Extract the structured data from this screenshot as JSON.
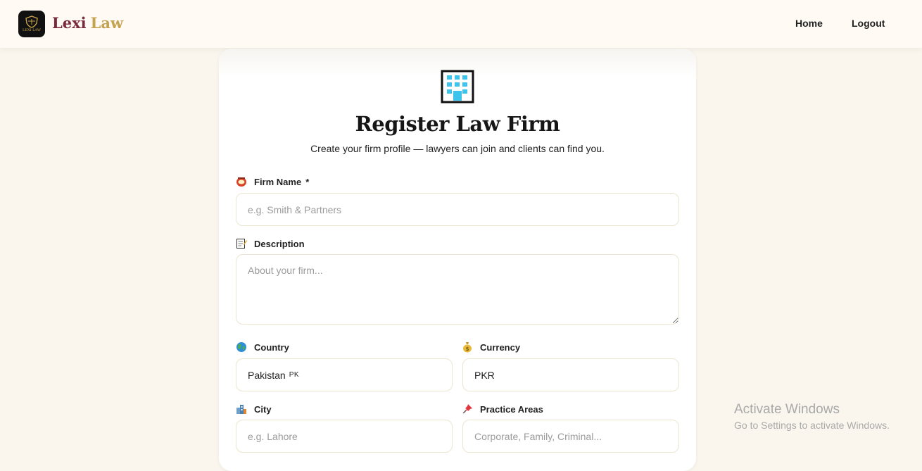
{
  "header": {
    "brand_part1": "Lexi",
    "brand_part2": "Law",
    "logo_small_text": "LEXI LAW",
    "nav": {
      "home": "Home",
      "logout": "Logout"
    }
  },
  "form": {
    "title": "Register Law Firm",
    "subtitle": "Create your firm profile — lawyers can join and clients can find you.",
    "firm_name": {
      "label": "Firm Name",
      "required_mark": "*",
      "placeholder": "e.g. Smith & Partners",
      "icon": "scales-icon"
    },
    "description": {
      "label": "Description",
      "placeholder": "About your firm...",
      "icon": "memo-icon"
    },
    "country": {
      "label": "Country",
      "value": "Pakistan",
      "flag_code": "PK",
      "icon": "globe-icon"
    },
    "currency": {
      "label": "Currency",
      "value": "PKR",
      "icon": "money-bag-icon"
    },
    "city": {
      "label": "City",
      "placeholder": "e.g. Lahore",
      "icon": "cityscape-icon"
    },
    "practice_areas": {
      "label": "Practice Areas",
      "placeholder": "Corporate, Family, Criminal...",
      "icon": "pushpin-icon"
    }
  },
  "system": {
    "activate_title": "Activate Windows",
    "activate_sub": "Go to Settings to activate Windows."
  },
  "colors": {
    "brand_maroon": "#7a2a3f",
    "brand_gold": "#c4a24f",
    "page_bg": "#faf6ee",
    "field_border": "#ebe6cf"
  }
}
